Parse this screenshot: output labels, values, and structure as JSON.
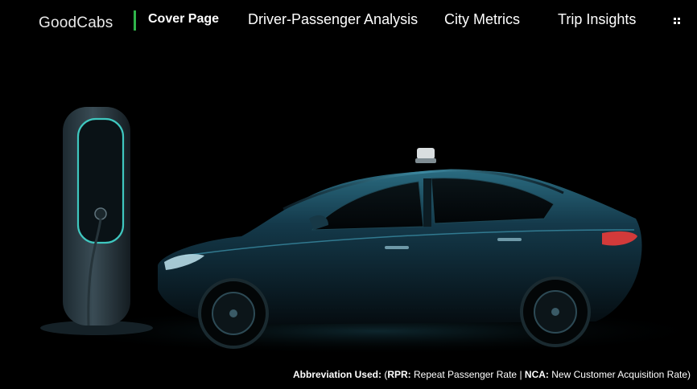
{
  "nav": {
    "brand": "GoodCabs",
    "items": [
      {
        "label": "Cover Page",
        "active": true
      },
      {
        "label": "Driver-Passenger Analysis",
        "active": false
      },
      {
        "label": "City Metrics",
        "active": false
      },
      {
        "label": "Trip Insights",
        "active": false
      }
    ],
    "grid_icon": "grid-icon",
    "accent_color": "#2fb44a"
  },
  "hero": {
    "description_icon_charger": "ev-charger-icon",
    "description_icon_car": "taxi-car-icon"
  },
  "footnote": {
    "lead": "Abbreviation Used:",
    "paren_open": "(",
    "rpr_key": "RPR:",
    "rpr_text": "Repeat Passenger Rate",
    "sep": "|",
    "nca_key": "NCA:",
    "nca_text": "New Customer Acquisition Rate)"
  }
}
